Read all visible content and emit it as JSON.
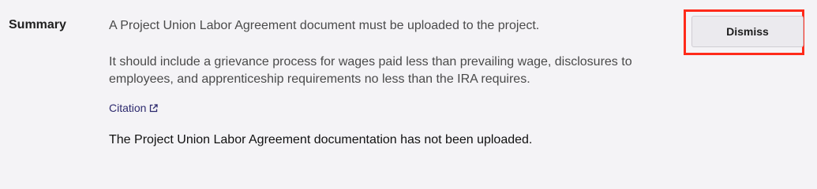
{
  "summary": {
    "label": "Summary",
    "paragraph1": "A Project Union Labor Agreement document must be uploaded to the project.",
    "paragraph2": "It should include a grievance process for wages paid less than prevailing wage, disclosures to employees, and apprenticeship requirements no less than the IRA requires.",
    "citation_label": "Citation",
    "status_text": "The Project Union Labor Agreement documentation has not been uploaded."
  },
  "actions": {
    "dismiss_label": "Dismiss"
  },
  "colors": {
    "background": "#f4f3f6",
    "highlight": "#ff2a1a",
    "citation": "#2d2a6e"
  }
}
